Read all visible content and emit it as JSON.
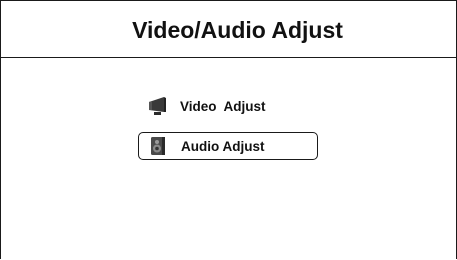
{
  "header": {
    "title": "Video/Audio Adjust"
  },
  "menu": {
    "items": [
      {
        "label": "Video  Adjust",
        "icon": "tv-monitor-icon",
        "selected": false
      },
      {
        "label": "Audio Adjust",
        "icon": "speaker-icon",
        "selected": true
      }
    ]
  },
  "colors": {
    "text": "#111111",
    "border": "#1a1a1a",
    "background": "#ffffff",
    "icon_fill": "#444444"
  }
}
